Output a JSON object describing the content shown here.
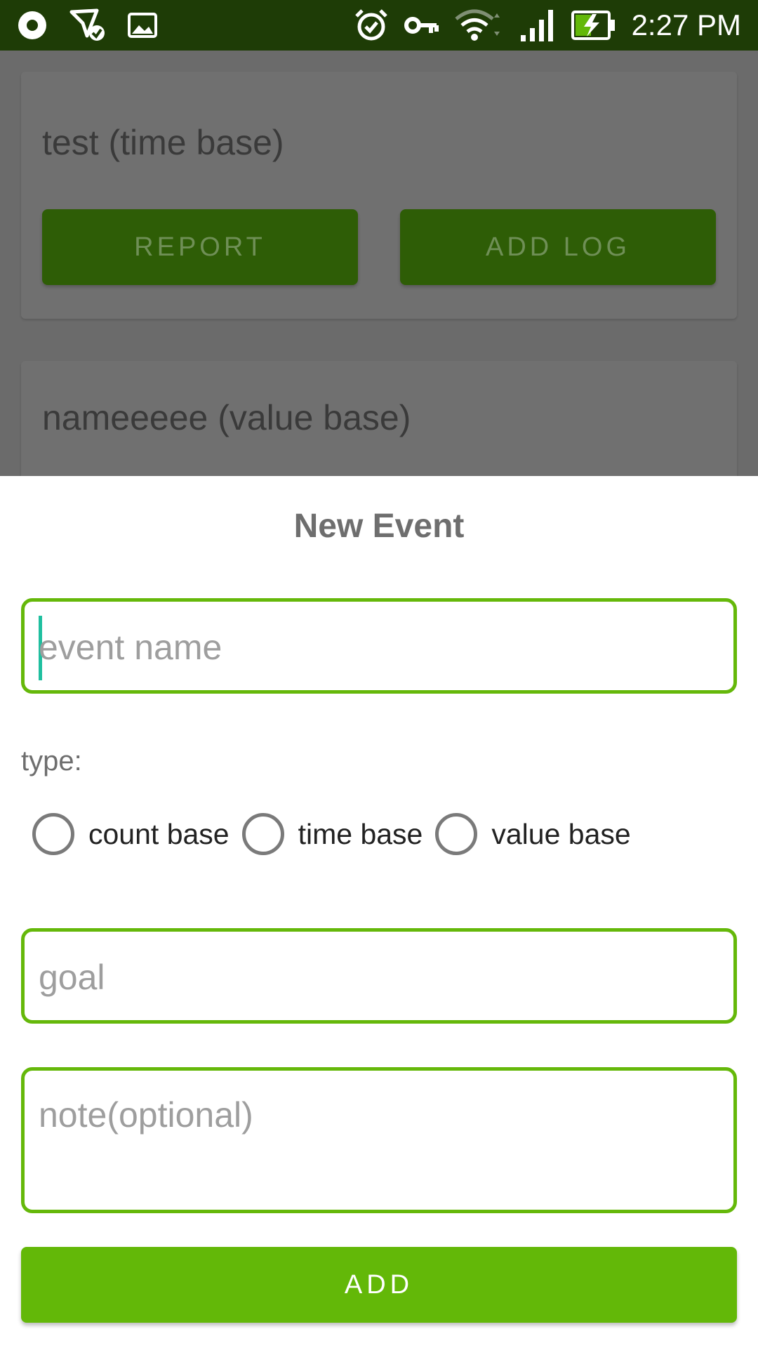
{
  "status_bar": {
    "time": "2:27 PM",
    "icons": [
      "record-icon",
      "location-check-icon",
      "image-icon",
      "alarm-icon",
      "vpn-key-icon",
      "wifi-icon",
      "signal-icon",
      "battery-charging-icon"
    ]
  },
  "background_list": {
    "cards": [
      {
        "title": "test (time base)",
        "report_label": "REPORT",
        "add_log_label": "ADD LOG"
      },
      {
        "title": "nameeeee (value base)"
      }
    ]
  },
  "dialog": {
    "title": "New Event",
    "event_name": {
      "value": "",
      "placeholder": "event name"
    },
    "type_label": "type:",
    "type_options": [
      "count base",
      "time base",
      "value base"
    ],
    "goal": {
      "value": "",
      "placeholder": "goal"
    },
    "note": {
      "value": "",
      "placeholder": "note(optional)"
    },
    "add_label": "ADD"
  },
  "colors": {
    "status_bar": "#1e3c06",
    "accent": "#63b808",
    "field_border": "#65b80a",
    "dim_button": "#2e5d06",
    "caret": "#1fbf9f"
  }
}
